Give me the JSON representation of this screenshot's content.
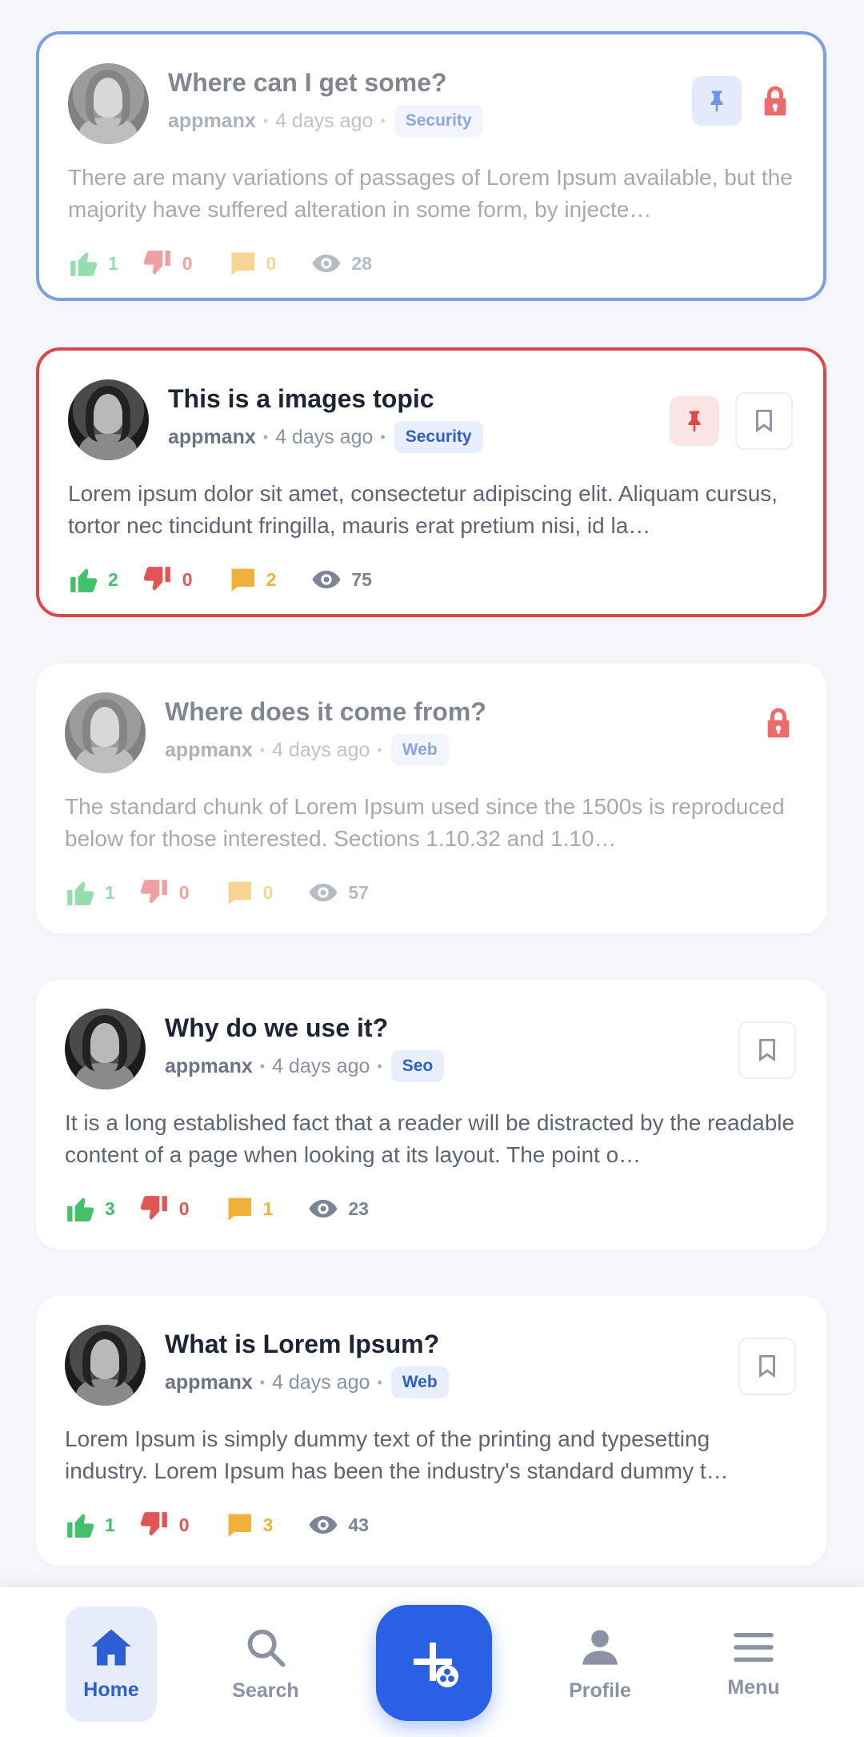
{
  "colors": {
    "accent": "#2a60e6",
    "like": "#43c06a",
    "dislike": "#e25555",
    "comment": "#f0b23a",
    "lock": "#ee6b6b"
  },
  "posts": [
    {
      "title": "Where can I get some?",
      "author": "appmanx",
      "time": "4 days ago",
      "tag": "Security",
      "excerpt": "There are many variations of passages of Lorem Ipsum available, but the majority have suffered alteration in some form, by injecte…",
      "likes": "1",
      "dislikes": "0",
      "comments": "0",
      "views": "28"
    },
    {
      "title": "This is a images topic",
      "author": "appmanx",
      "time": "4 days ago",
      "tag": "Security",
      "excerpt": "Lorem ipsum dolor sit amet, consectetur adipiscing elit. Aliquam cursus, tortor nec tincidunt fringilla, mauris erat pretium nisi, id la…",
      "likes": "2",
      "dislikes": "0",
      "comments": "2",
      "views": "75"
    },
    {
      "title": "Where does it come from?",
      "author": "appmanx",
      "time": "4 days ago",
      "tag": "Web",
      "excerpt": "The standard chunk of Lorem Ipsum used since the 1500s is reproduced below for those interested. Sections 1.10.32 and 1.10…",
      "likes": "1",
      "dislikes": "0",
      "comments": "0",
      "views": "57"
    },
    {
      "title": "Why do we use it?",
      "author": "appmanx",
      "time": "4 days ago",
      "tag": "Seo",
      "excerpt": "It is a long established fact that a reader will be distracted by the readable content of a page when looking at its layout. The point o…",
      "likes": "3",
      "dislikes": "0",
      "comments": "1",
      "views": "23"
    },
    {
      "title": "What is Lorem Ipsum?",
      "author": "appmanx",
      "time": "4 days ago",
      "tag": "Web",
      "excerpt": "Lorem Ipsum is simply dummy text of the printing and typesetting industry. Lorem Ipsum has been the industry's standard dummy t…",
      "likes": "1",
      "dislikes": "0",
      "comments": "3",
      "views": "43"
    }
  ],
  "nav": {
    "home": "Home",
    "search": "Search",
    "profile": "Profile",
    "menu": "Menu"
  }
}
